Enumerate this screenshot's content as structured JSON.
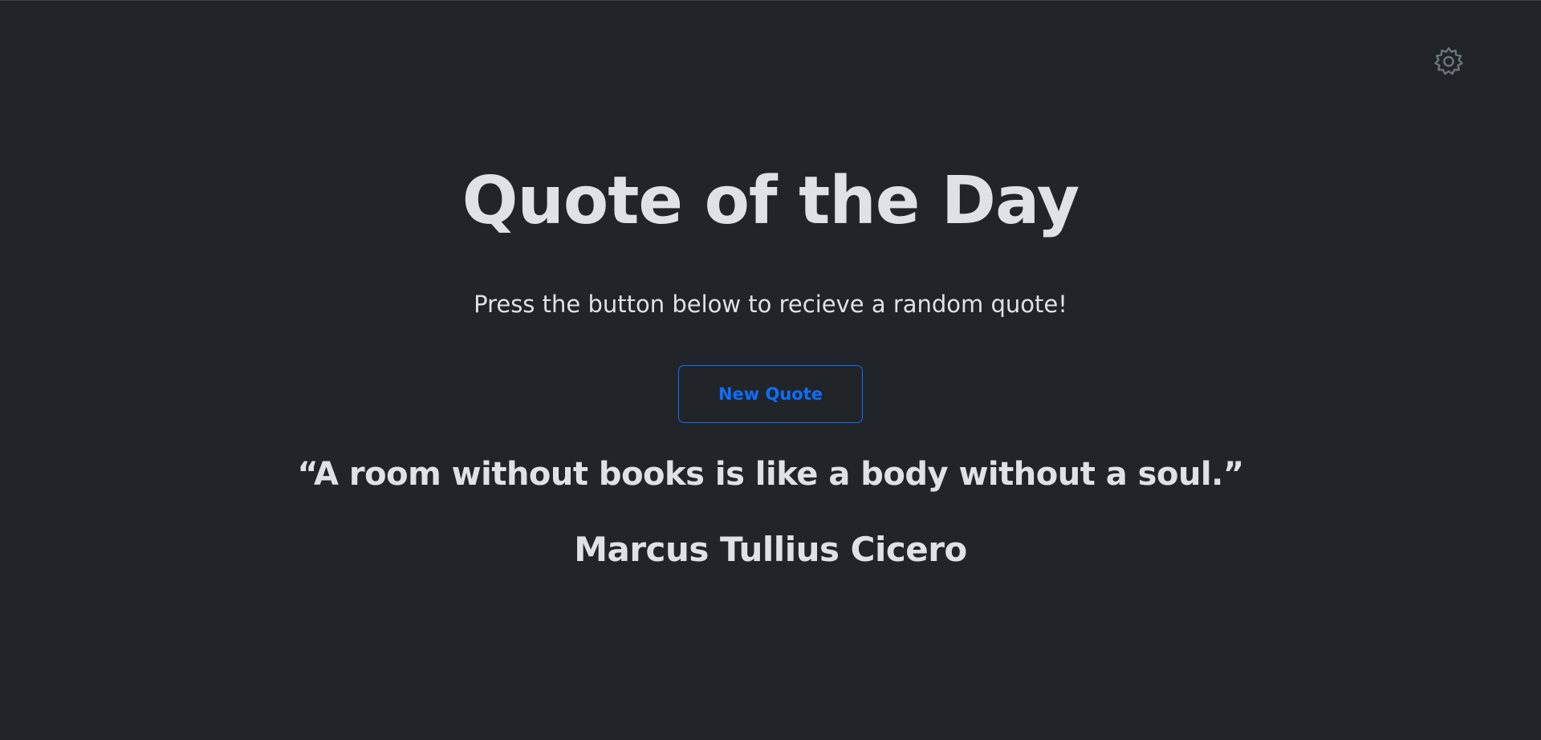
{
  "header": {
    "settings_icon": "gear-icon"
  },
  "main": {
    "title": "Quote of the Day",
    "subtitle": "Press the button below to recieve a random quote!",
    "button_label": "New Quote",
    "quote_text": "“A room without books is like a body without a soul.”",
    "quote_author": "Marcus Tullius Cicero"
  },
  "colors": {
    "background": "#212529",
    "text": "#dee2e6",
    "accent": "#0d6efd",
    "icon": "#6c757d"
  }
}
